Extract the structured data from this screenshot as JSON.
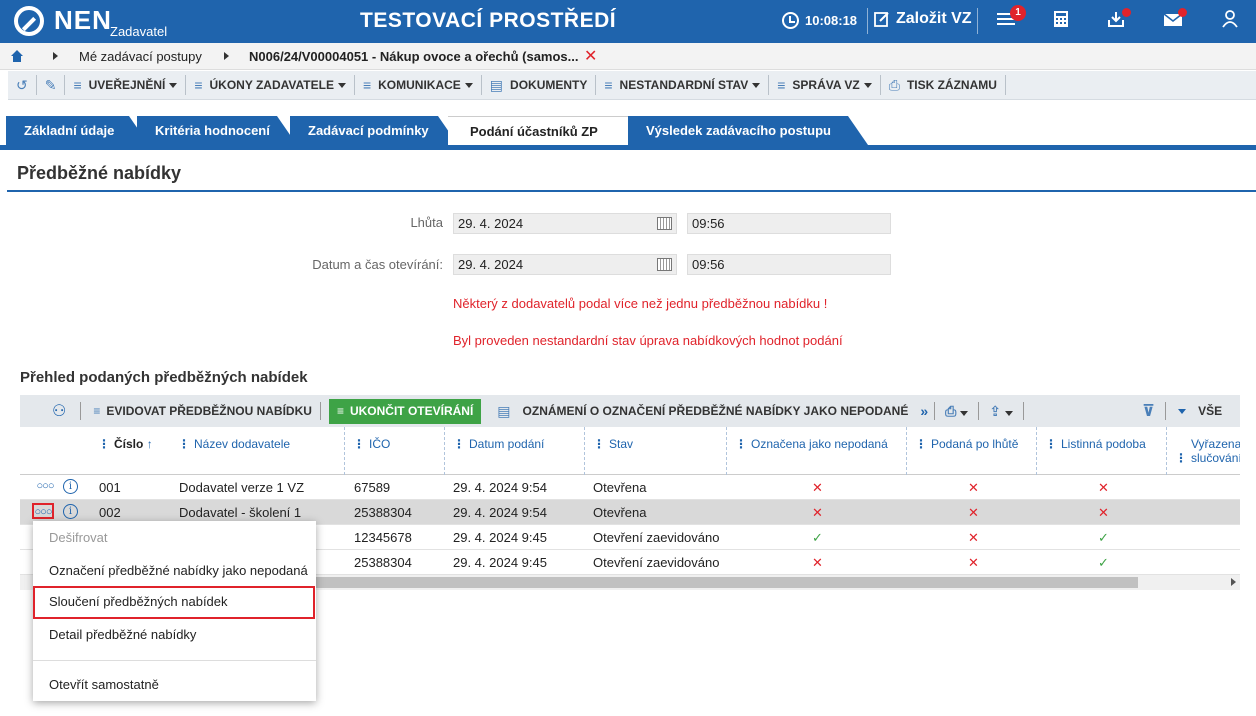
{
  "header": {
    "logo": "NEN",
    "logo_sub": "Zadavatel",
    "env_title": "TESTOVACÍ PROSTŘEDÍ",
    "time": "10:08:18",
    "create_label": "Založit VZ",
    "notifications_count": "1"
  },
  "breadcrumb": {
    "item1": "Mé zadávací postupy",
    "item2": "N006/24/V00004051 - Nákup ovoce a ořechů (samos..."
  },
  "toolbar": {
    "publish": "UVEŘEJNĚNÍ",
    "actions": "ÚKONY ZADAVATELE",
    "communication": "KOMUNIKACE",
    "documents": "DOKUMENTY",
    "nonstandard": "NESTANDARDNÍ STAV",
    "management": "SPRÁVA VZ",
    "print": "TISK ZÁZNAMU"
  },
  "tabs": [
    "Základní údaje",
    "Kritéria hodnocení",
    "Zadávací podmínky",
    "Podání účastníků ZP",
    "Výsledek zadávacího postupu"
  ],
  "section_title": "Předběžné nabídky",
  "form": {
    "deadline_label": "Lhůta",
    "deadline_date": "29. 4. 2024",
    "deadline_time": "09:56",
    "opening_label": "Datum a čas otevírání:",
    "opening_date": "29. 4. 2024",
    "opening_time": "09:56",
    "warning1": "Některý z dodavatelů podal více než jednu předběžnou nabídku !",
    "warning2": "Byl proveden nestandardní stav úprava nabídkových hodnot podání"
  },
  "grid": {
    "title": "Přehled podaných předběžných nabídek",
    "record_btn": "EVIDOVAT PŘEDBĚŽNOU NABÍDKU",
    "finish_btn": "UKONČIT OTEVÍRÁNÍ",
    "notice_btn": "OZNÁMENÍ O OZNAČENÍ PŘEDBĚŽNÉ NABÍDKY JAKO NEPODANÉ",
    "all_label": "VŠE",
    "columns": [
      "Číslo",
      "Název dodavatele",
      "IČO",
      "Datum podání",
      "Stav",
      "Označena jako nepodaná",
      "Podaná po lhůtě",
      "Listinná podoba",
      "Vyřazena slučováním"
    ],
    "rows": [
      {
        "num": "001",
        "name": "Dodavatel verze 1 VZ",
        "ico": "67589",
        "date": "29. 4. 2024 9:54",
        "state": "Otevřena",
        "marked": "✕",
        "late": "✕",
        "paper": "✕"
      },
      {
        "num": "002",
        "name": "Dodavatel - školení 1",
        "ico": "25388304",
        "date": "29. 4. 2024 9:54",
        "state": "Otevřena",
        "marked": "✕",
        "late": "✕",
        "paper": "✕"
      },
      {
        "num": "",
        "name": "",
        "ico": "12345678",
        "date": "29. 4. 2024 9:45",
        "state": "Otevření zaevidováno",
        "marked": "✓",
        "late": "✕",
        "paper": "✓"
      },
      {
        "num": "",
        "name": "",
        "ico": "25388304",
        "date": "29. 4. 2024 9:45",
        "state": "Otevření zaevidováno",
        "marked": "✕",
        "late": "✕",
        "paper": "✓"
      }
    ]
  },
  "menu": {
    "decrypt": "Dešifrovat",
    "mark_unsubmitted": "Označení předběžné nabídky jako nepodaná",
    "merge": "Sloučení předběžných nabídek",
    "detail": "Detail předběžné nabídky",
    "open_separately": "Otevřít samostatně"
  }
}
